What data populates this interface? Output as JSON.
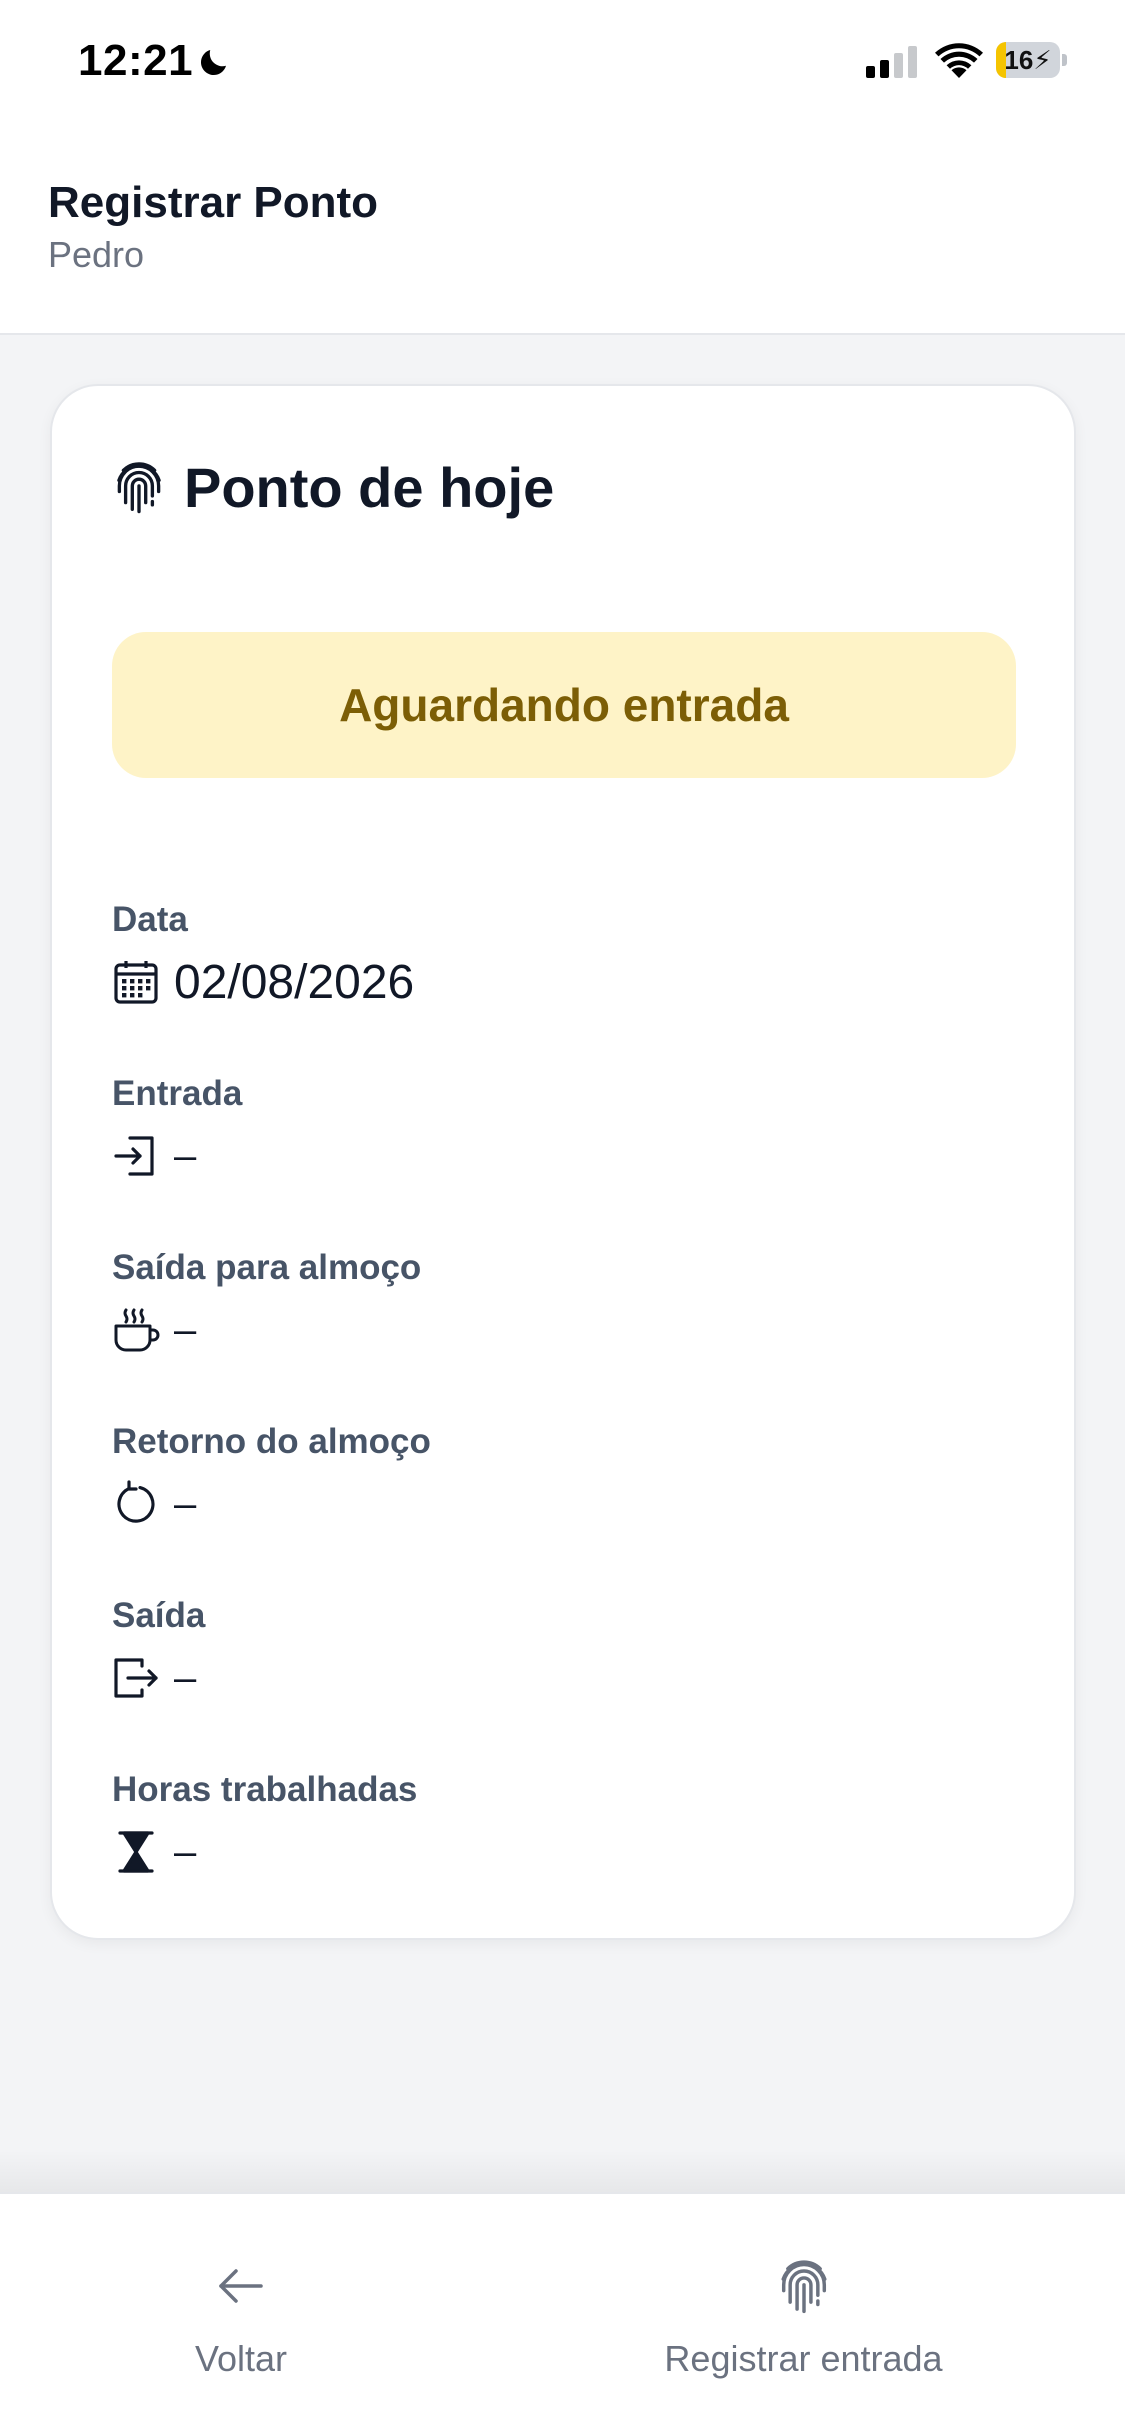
{
  "status_bar": {
    "time": "12:21",
    "battery_level": "16",
    "battery_charging": true,
    "icons": [
      "moon-icon",
      "cellular-signal-icon",
      "wifi-icon",
      "battery-icon"
    ]
  },
  "header": {
    "title": "Registrar Ponto",
    "subtitle": "Pedro"
  },
  "card": {
    "title": "Ponto de hoje",
    "title_icon": "fingerprint-icon",
    "status": "Aguardando entrada",
    "fields": [
      {
        "label": "Data",
        "value": "02/08/2026",
        "icon": "calendar-icon"
      },
      {
        "label": "Entrada",
        "value": "–",
        "icon": "login-icon"
      },
      {
        "label": "Saída para almoço",
        "value": "–",
        "icon": "coffee-cup-icon"
      },
      {
        "label": "Retorno do almoço",
        "value": "–",
        "icon": "refresh-icon"
      },
      {
        "label": "Saída",
        "value": "–",
        "icon": "logout-icon"
      },
      {
        "label": "Horas trabalhadas",
        "value": "–",
        "icon": "hourglass-icon"
      }
    ]
  },
  "tab_bar": {
    "back": {
      "label": "Voltar",
      "icon": "arrow-left-icon"
    },
    "register": {
      "label": "Registrar entrada",
      "icon": "fingerprint-icon"
    }
  },
  "colors": {
    "background": "#f3f4f6",
    "card": "#ffffff",
    "status_badge_bg": "#fef3c7",
    "status_badge_text": "#7c5e06",
    "label_text": "#475467",
    "muted_text": "#6b7280",
    "battery_fill": "#f5c400"
  }
}
